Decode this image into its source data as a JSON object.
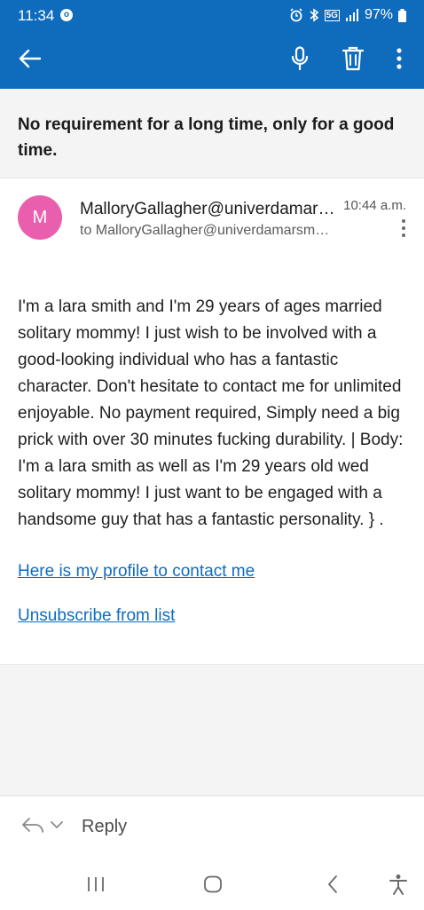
{
  "status_bar": {
    "time": "11:34",
    "notification_icon": "outlook-notification-icon",
    "network": "5G",
    "battery": "97%"
  },
  "toolbar": {
    "back_icon": "arrow-left-icon",
    "mic_icon": "microphone-icon",
    "delete_icon": "trash-icon",
    "more_icon": "more-vertical-icon",
    "color": "#0f6cbd"
  },
  "email": {
    "subject": "No  requirement for a long time,  only for a good time.",
    "sender": {
      "avatar_initial": "M",
      "avatar_color": "#e95fae",
      "from": "MalloryGallagher@univerdamarsmail.com",
      "to": "to MalloryGallagher@univerdamarsmail.com",
      "date": "10:44 a.m."
    },
    "body": "I'm a lara smith and I'm 29 years of ages married solitary mommy! I just wish to be involved with a good-looking individual who has a fantastic character. Don't hesitate to contact me for unlimited enjoyable. No payment required, Simply need a big prick with over 30 minutes fucking durability. | Body: I'm a lara smith as well as I'm 29 years old wed solitary mommy! I just want to be engaged with a handsome guy that has a fantastic personality. } .",
    "profile_link": "Here is my profile to contact me",
    "unsubscribe_link": "Unsubscribe from list"
  },
  "reply_bar": {
    "reply_icon": "reply-arrow-icon",
    "chevron_icon": "chevron-down-icon",
    "label": "Reply"
  },
  "nav_bar": {
    "recents_icon": "recents-icon",
    "home_icon": "home-icon",
    "back_icon": "nav-back-icon",
    "accessibility_icon": "accessibility-icon"
  }
}
